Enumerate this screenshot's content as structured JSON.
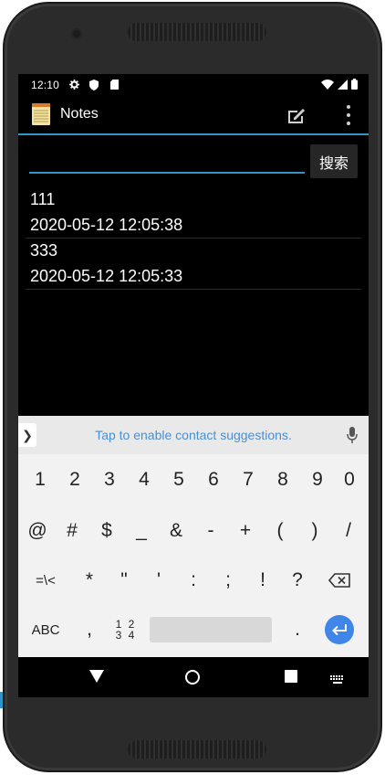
{
  "status_bar": {
    "time": "12:10",
    "icons": [
      "gear-icon",
      "shield-icon",
      "sdcard-icon",
      "wifi-icon",
      "signal-icon",
      "battery-icon"
    ]
  },
  "app_bar": {
    "title": "Notes",
    "icons": [
      "notepad-icon",
      "edit-icon",
      "more-vert-icon"
    ]
  },
  "search": {
    "value": "",
    "placeholder": "",
    "button_label": "搜索"
  },
  "notes": [
    {
      "title": "111",
      "timestamp": "2020-05-12 12:05:38"
    },
    {
      "title": "333",
      "timestamp": "2020-05-12 12:05:33"
    }
  ],
  "keyboard": {
    "suggestion_text": "Tap to enable contact suggestions.",
    "row1": [
      "1",
      "2",
      "3",
      "4",
      "5",
      "6",
      "7",
      "8",
      "9",
      "0"
    ],
    "row2": [
      "@",
      "#",
      "$",
      "_",
      "&",
      "-",
      "+",
      "(",
      ")",
      "/"
    ],
    "row3": [
      "=\\<",
      "*",
      "\"",
      "'",
      ":",
      ";",
      "!",
      "?"
    ],
    "row4": {
      "abc": "ABC",
      "comma": ",",
      "numpad_top": "1 2",
      "numpad_bottom": "3 4",
      "period": "."
    }
  },
  "colors": {
    "accent": "#2f95c8",
    "link": "#4a8fd3",
    "enter_key": "#3f86e8"
  }
}
